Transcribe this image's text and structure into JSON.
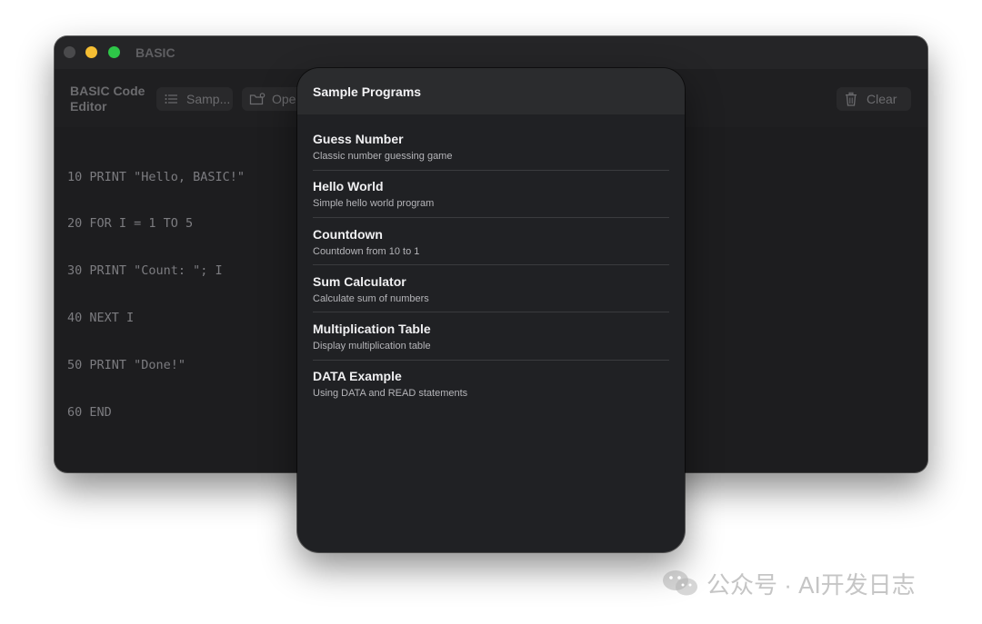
{
  "window": {
    "title": "BASIC",
    "heading": "BASIC Code Editor"
  },
  "toolbar": {
    "samples_label": "Samp...",
    "open_label": "Ope",
    "clear_label": "Clear",
    "icons": {
      "samples": "list-icon",
      "open": "folder-badge-icon",
      "clear": "trash-icon"
    }
  },
  "editor": {
    "lines": [
      "10 PRINT \"Hello, BASIC!\"",
      "20 FOR I = 1 TO 5",
      "30 PRINT \"Count: \"; I",
      "40 NEXT I",
      "50 PRINT \"Done!\"",
      "60 END"
    ]
  },
  "sheet": {
    "title": "Sample Programs",
    "programs": [
      {
        "name": "Guess Number",
        "description": "Classic number guessing game"
      },
      {
        "name": "Hello World",
        "description": "Simple hello world program"
      },
      {
        "name": "Countdown",
        "description": "Countdown from 10 to 1"
      },
      {
        "name": "Sum Calculator",
        "description": "Calculate sum of numbers"
      },
      {
        "name": "Multiplication Table",
        "description": "Display multiplication table"
      },
      {
        "name": "DATA Example",
        "description": "Using DATA and READ statements"
      }
    ]
  },
  "watermark": {
    "text": "公众号 · AI开发日志",
    "icon": "wechat-icon"
  },
  "colors": {
    "window_bg": "#1d1d1f",
    "sheet_bg": "#202124",
    "traffic_yellow": "#f5be33",
    "traffic_green": "#2ec748"
  }
}
